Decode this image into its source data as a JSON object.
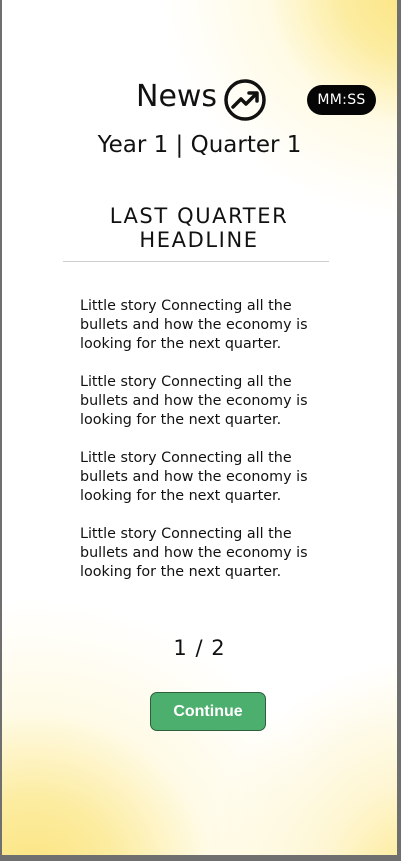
{
  "header": {
    "title": "News",
    "icon": "trending-up-icon",
    "timer": "MM:SS"
  },
  "period": "Year 1 | Quarter 1",
  "headline": {
    "line1": "LAST QUARTER",
    "line2": "HEADLINE"
  },
  "stories": [
    "Little story Connecting all the bullets and how the economy is looking for the next quarter.",
    "Little story Connecting all the bullets and how the economy is looking for the next quarter.",
    "Little story Connecting all the bullets and how the economy is looking for the next quarter.",
    "Little story Connecting all the bullets and how the economy is looking for the next quarter."
  ],
  "pager": "1 / 2",
  "continue_label": "Continue",
  "colors": {
    "accent_button": "#4daf6e",
    "timer_badge": "#050505",
    "background_glow": "#fbe37e"
  }
}
